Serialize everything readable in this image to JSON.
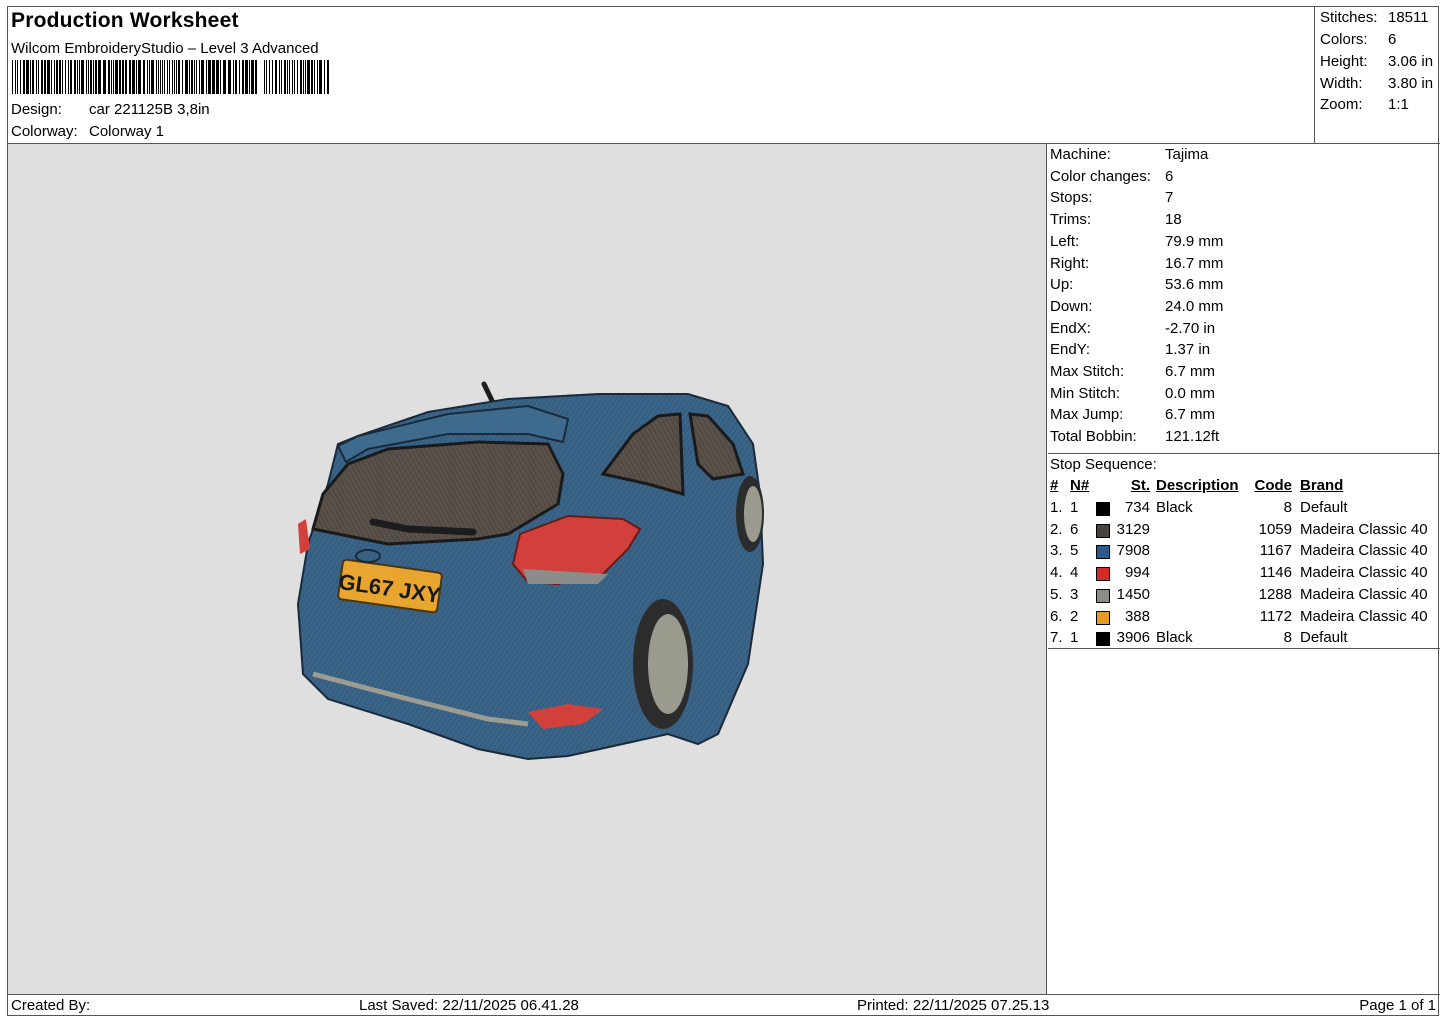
{
  "header": {
    "title": "Production Worksheet",
    "software": "Wilcom EmbroideryStudio – Level 3 Advanced",
    "design_label": "Design:",
    "design_value": "car 221125B 3,8in",
    "colorway_label": "Colorway:",
    "colorway_value": "Colorway 1"
  },
  "stats": {
    "stitches_label": "Stitches:",
    "stitches": "18511",
    "colors_label": "Colors:",
    "colors": "6",
    "height_label": "Height:",
    "height": "3.06 in",
    "width_label": "Width:",
    "width": "3.80 in",
    "zoom_label": "Zoom:",
    "zoom": "1:1"
  },
  "preview": {
    "plate_text": "GL67 JXY"
  },
  "machine": [
    {
      "label": "Machine:",
      "value": "Tajima"
    },
    {
      "label": "Color changes:",
      "value": "6"
    },
    {
      "label": "Stops:",
      "value": "7"
    },
    {
      "label": "Trims:",
      "value": "18"
    },
    {
      "label": "Left:",
      "value": "79.9 mm"
    },
    {
      "label": "Right:",
      "value": "16.7 mm"
    },
    {
      "label": "Up:",
      "value": "53.6 mm"
    },
    {
      "label": "Down:",
      "value": "24.0 mm"
    },
    {
      "label": "EndX:",
      "value": "-2.70 in"
    },
    {
      "label": "EndY:",
      "value": "1.37 in"
    },
    {
      "label": "Max Stitch:",
      "value": "6.7 mm"
    },
    {
      "label": "Min Stitch:",
      "value": "0.0 mm"
    },
    {
      "label": "Max Jump:",
      "value": "6.7 mm"
    },
    {
      "label": "Total Bobbin:",
      "value": "121.12ft"
    }
  ],
  "sequence": {
    "title": "Stop Sequence:",
    "headers": {
      "idx": "#",
      "n": "N#",
      "st": "St.",
      "desc": "Description",
      "code": "Code",
      "brand": "Brand"
    },
    "rows": [
      {
        "idx": "1.",
        "n": "1",
        "color": "#000000",
        "st": "734",
        "desc": "Black",
        "code": "8",
        "brand": "Default"
      },
      {
        "idx": "2.",
        "n": "6",
        "color": "#4a423c",
        "st": "3129",
        "desc": "",
        "code": "1059",
        "brand": "Madeira Classic 40"
      },
      {
        "idx": "3.",
        "n": "5",
        "color": "#2c5a8c",
        "st": "7908",
        "desc": "",
        "code": "1167",
        "brand": "Madeira Classic 40"
      },
      {
        "idx": "4.",
        "n": "4",
        "color": "#d42a28",
        "st": "994",
        "desc": "",
        "code": "1146",
        "brand": "Madeira Classic 40"
      },
      {
        "idx": "5.",
        "n": "3",
        "color": "#8c8c88",
        "st": "1450",
        "desc": "",
        "code": "1288",
        "brand": "Madeira Classic 40"
      },
      {
        "idx": "6.",
        "n": "2",
        "color": "#e89a22",
        "st": "388",
        "desc": "",
        "code": "1172",
        "brand": "Madeira Classic 40"
      },
      {
        "idx": "7.",
        "n": "1",
        "color": "#000000",
        "st": "3906",
        "desc": "Black",
        "code": "8",
        "brand": "Default"
      }
    ]
  },
  "footer": {
    "created_by": "Created By:",
    "last_saved": "Last Saved: 22/11/2025 06.41.28",
    "printed": "Printed: 22/11/2025 07.25.13",
    "page": "Page 1 of 1"
  }
}
